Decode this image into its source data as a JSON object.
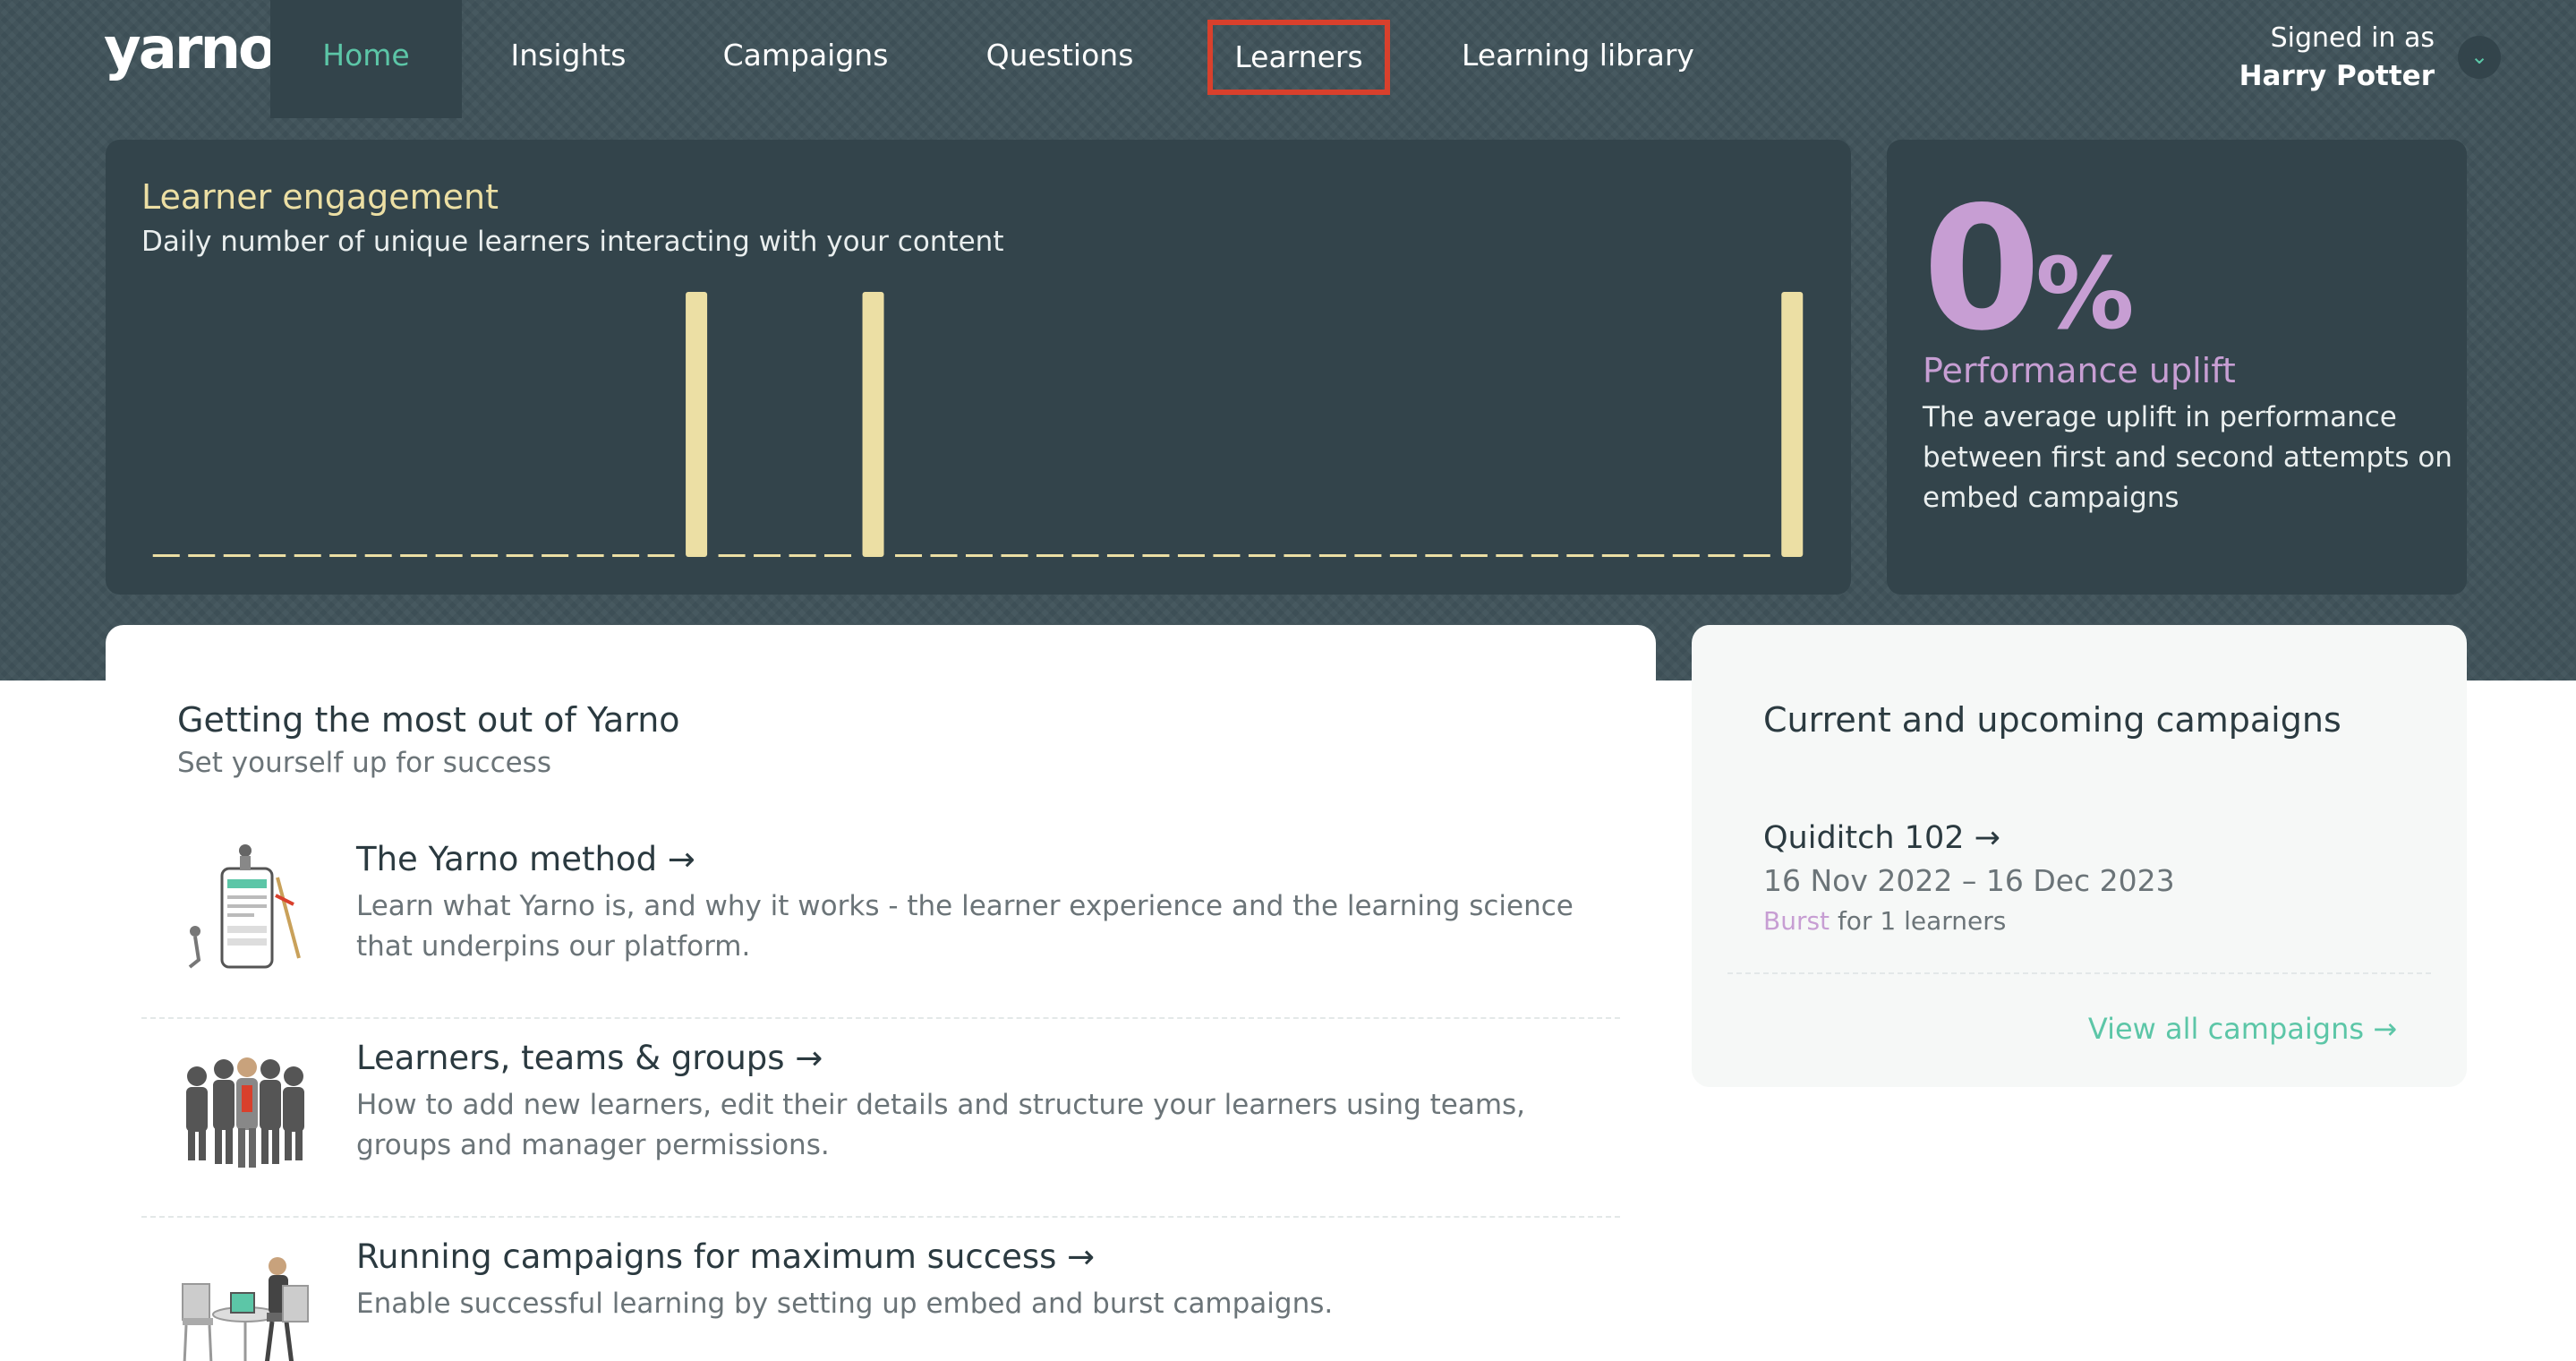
{
  "nav": {
    "logo": "yarno",
    "items": [
      {
        "label": "Home",
        "active": true
      },
      {
        "label": "Insights"
      },
      {
        "label": "Campaigns"
      },
      {
        "label": "Questions"
      },
      {
        "label": "Learners",
        "highlighted": true
      },
      {
        "label": "Learning library"
      }
    ],
    "signed_in_label": "Signed in as",
    "user_name": "Harry Potter"
  },
  "engagement": {
    "title": "Learner engagement",
    "subtitle": "Daily number of unique learners interacting with your content"
  },
  "chart_data": {
    "type": "bar",
    "title": "Learner engagement",
    "subtitle": "Daily number of unique learners interacting with your content",
    "xlabel": "",
    "ylabel": "",
    "grid": false,
    "legend": "none",
    "x_days": 47,
    "values": [
      0,
      0,
      0,
      0,
      0,
      0,
      0,
      0,
      0,
      0,
      0,
      0,
      0,
      0,
      0,
      1,
      0,
      0,
      0,
      0,
      1,
      0,
      0,
      0,
      0,
      0,
      0,
      0,
      0,
      0,
      0,
      0,
      0,
      0,
      0,
      0,
      0,
      0,
      0,
      0,
      0,
      0,
      0,
      0,
      0,
      0,
      1
    ],
    "ylim": [
      0,
      1
    ],
    "colors": {
      "bar": "#ecdfa4"
    }
  },
  "uplift": {
    "value": "0",
    "unit": "%",
    "title": "Performance uplift",
    "description": "The average uplift in performance between first and second attempts on embed campaigns"
  },
  "guides": {
    "title": "Getting the most out of Yarno",
    "subtitle": "Set yourself up for success",
    "items": [
      {
        "title": "The Yarno method →",
        "description": "Learn what Yarno is, and why it works - the learner experience and the learning science that underpins our platform.",
        "icon": "phone-illustration"
      },
      {
        "title": "Learners, teams & groups →",
        "description": "How to add new learners, edit their details and structure your learners using teams, groups and manager permissions.",
        "icon": "people-group-illustration"
      },
      {
        "title": "Running campaigns for maximum success →",
        "description": "Enable successful learning by setting up embed and burst campaigns.",
        "icon": "desk-illustration"
      }
    ]
  },
  "campaigns": {
    "title": "Current and upcoming campaigns",
    "items": [
      {
        "name": "Quiditch 102 →",
        "dates": "16 Nov 2022 – 16 Dec 2023",
        "type": "Burst",
        "learners_text": "for 1 learners"
      }
    ],
    "view_all": "View all campaigns →"
  },
  "colors": {
    "accent": "#5cc6a7",
    "highlight_box": "#d9402c",
    "purple": "#c79ed3",
    "yellow": "#ecdfa4"
  }
}
